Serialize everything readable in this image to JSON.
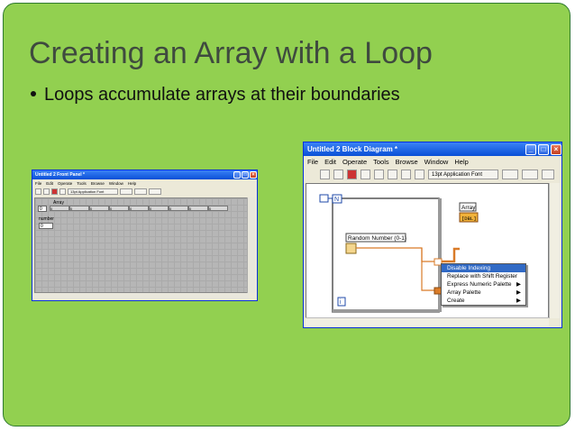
{
  "slide": {
    "title": "Creating an Array with a Loop",
    "bullet": "Loops accumulate arrays at their boundaries"
  },
  "front_panel": {
    "title": "Untitled 2 Front Panel *",
    "menu": [
      "File",
      "Edit",
      "Operate",
      "Tools",
      "Browse",
      "Window",
      "Help"
    ],
    "font_select": "13pt Application Font",
    "array_label": "Array",
    "array_index": "0",
    "array_cells": [
      "0",
      "0",
      "0",
      "0",
      "0",
      "0",
      "0",
      "0",
      "0"
    ],
    "number_label": "number",
    "number_value": "0"
  },
  "block_diagram": {
    "title": "Untitled 2 Block Diagram *",
    "menu": [
      "File",
      "Edit",
      "Operate",
      "Tools",
      "Browse",
      "Window",
      "Help"
    ],
    "font_select": "13pt Application Font",
    "loop_count_label": "N",
    "loop_iter_label": "i",
    "random_label": "Random Number (0-1)",
    "array_indicator_label": "Array",
    "array_indicator_type": "[DBL]",
    "number_indicator_label": "number",
    "number_indicator_type": "DBL",
    "context_menu": [
      "Disable Indexing",
      "Replace with Shift Register",
      "Express Numeric Palette",
      "Array Palette",
      "Create"
    ],
    "selected_menu_index": 0
  },
  "colors": {
    "slide_bg": "#92d050",
    "title_text": "#3f4a3f",
    "wire_orange": "#d97b28",
    "menu_highlight": "#316ac5"
  }
}
